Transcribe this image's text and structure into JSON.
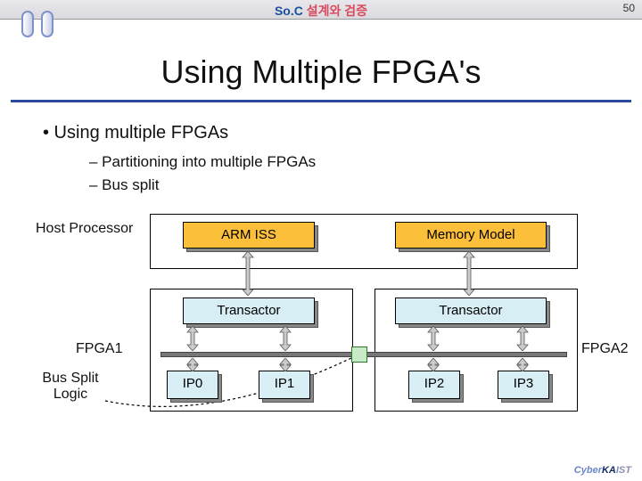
{
  "header": {
    "soc": "So.C",
    "rest": " 설계와 검증",
    "pagenum": "50"
  },
  "title": "Using Multiple FPGA's",
  "bullets": {
    "b1": "•  Using multiple FPGAs",
    "s1": "–  Partitioning into multiple FPGAs",
    "s2": "–  Bus split"
  },
  "labels": {
    "host": "Host Processor",
    "fpga1": "FPGA1",
    "fpga2": "FPGA2",
    "bus_split": "Bus Split Logic"
  },
  "blocks": {
    "arm": "ARM ISS",
    "mem": "Memory Model",
    "tr1": "Transactor",
    "tr2": "Transactor",
    "ip0": "IP0",
    "ip1": "IP1",
    "ip2": "IP2",
    "ip3": "IP3"
  },
  "footer": {
    "cy": "Cyber",
    "k1": "KA",
    "k2": "IST"
  }
}
